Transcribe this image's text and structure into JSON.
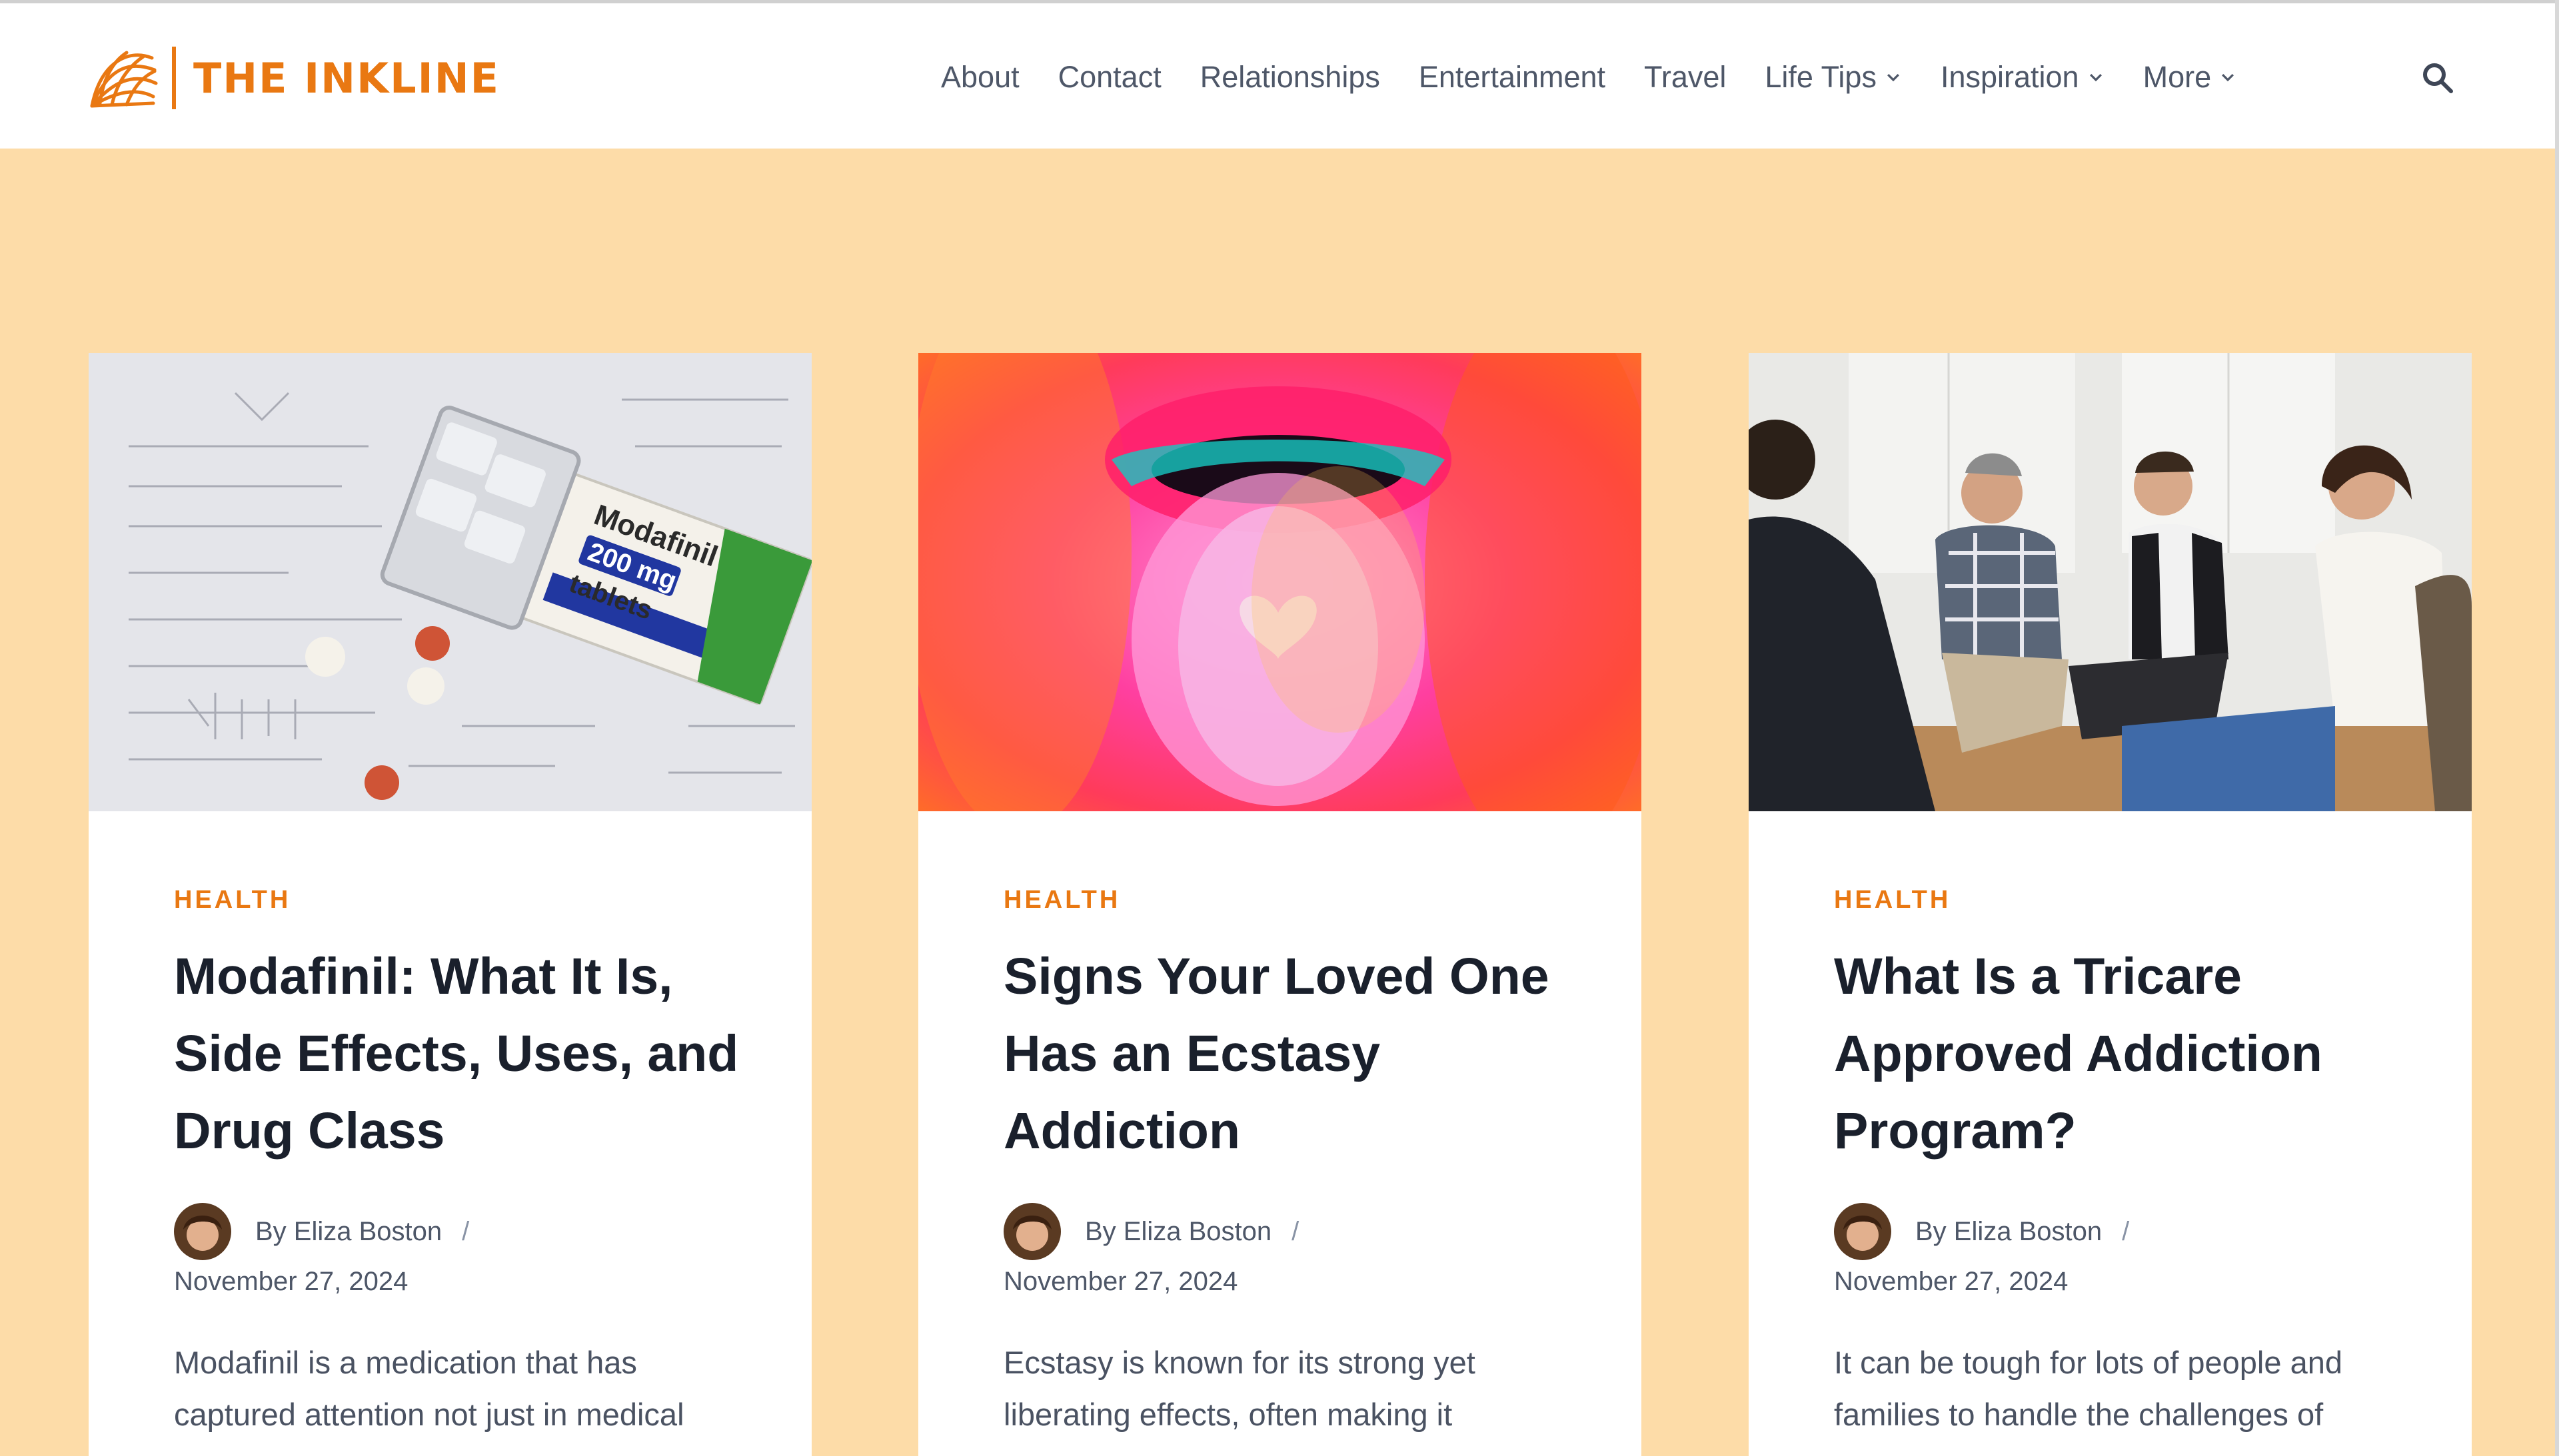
{
  "brand": {
    "name": "THE INKLINE",
    "accent_color": "#e97812"
  },
  "nav": {
    "items": [
      {
        "label": "About",
        "has_dropdown": false
      },
      {
        "label": "Contact",
        "has_dropdown": false
      },
      {
        "label": "Relationships",
        "has_dropdown": false
      },
      {
        "label": "Entertainment",
        "has_dropdown": false
      },
      {
        "label": "Travel",
        "has_dropdown": false
      },
      {
        "label": "Life Tips",
        "has_dropdown": true
      },
      {
        "label": "Inspiration",
        "has_dropdown": true
      },
      {
        "label": "More",
        "has_dropdown": true
      }
    ],
    "search_icon": "search-icon"
  },
  "colors": {
    "page_background": "#fddca8",
    "card_background": "#ffffff",
    "category": "#e97812",
    "title": "#1a202c",
    "text": "#4e5768"
  },
  "articles": [
    {
      "category": "HEALTH",
      "title": "Modafinil: What It Is, Side Effects, Uses, and Drug Class",
      "author": "By Eliza Boston",
      "separator": "/",
      "date": "November 27, 2024",
      "excerpt": "Modafinil is a medication that has captured attention not just in medical",
      "image": "modafinil-box-photo",
      "image_text": {
        "line1": "Modafinil",
        "line2": "200 mg",
        "line3": "tablets"
      }
    },
    {
      "category": "HEALTH",
      "title": "Signs Your Loved One Has an Ecstasy Addiction",
      "author": "By Eliza Boston",
      "separator": "/",
      "date": "November 27, 2024",
      "excerpt": "Ecstasy is known for its strong yet liberating effects, often making it",
      "image": "psychedelic-tongue-photo"
    },
    {
      "category": "HEALTH",
      "title": "What Is a Tricare Approved Addiction Program?",
      "author": "By Eliza Boston",
      "separator": "/",
      "date": "November 27, 2024",
      "excerpt": "It can be tough for lots of people and families to handle the challenges of",
      "image": "group-therapy-photo"
    }
  ]
}
